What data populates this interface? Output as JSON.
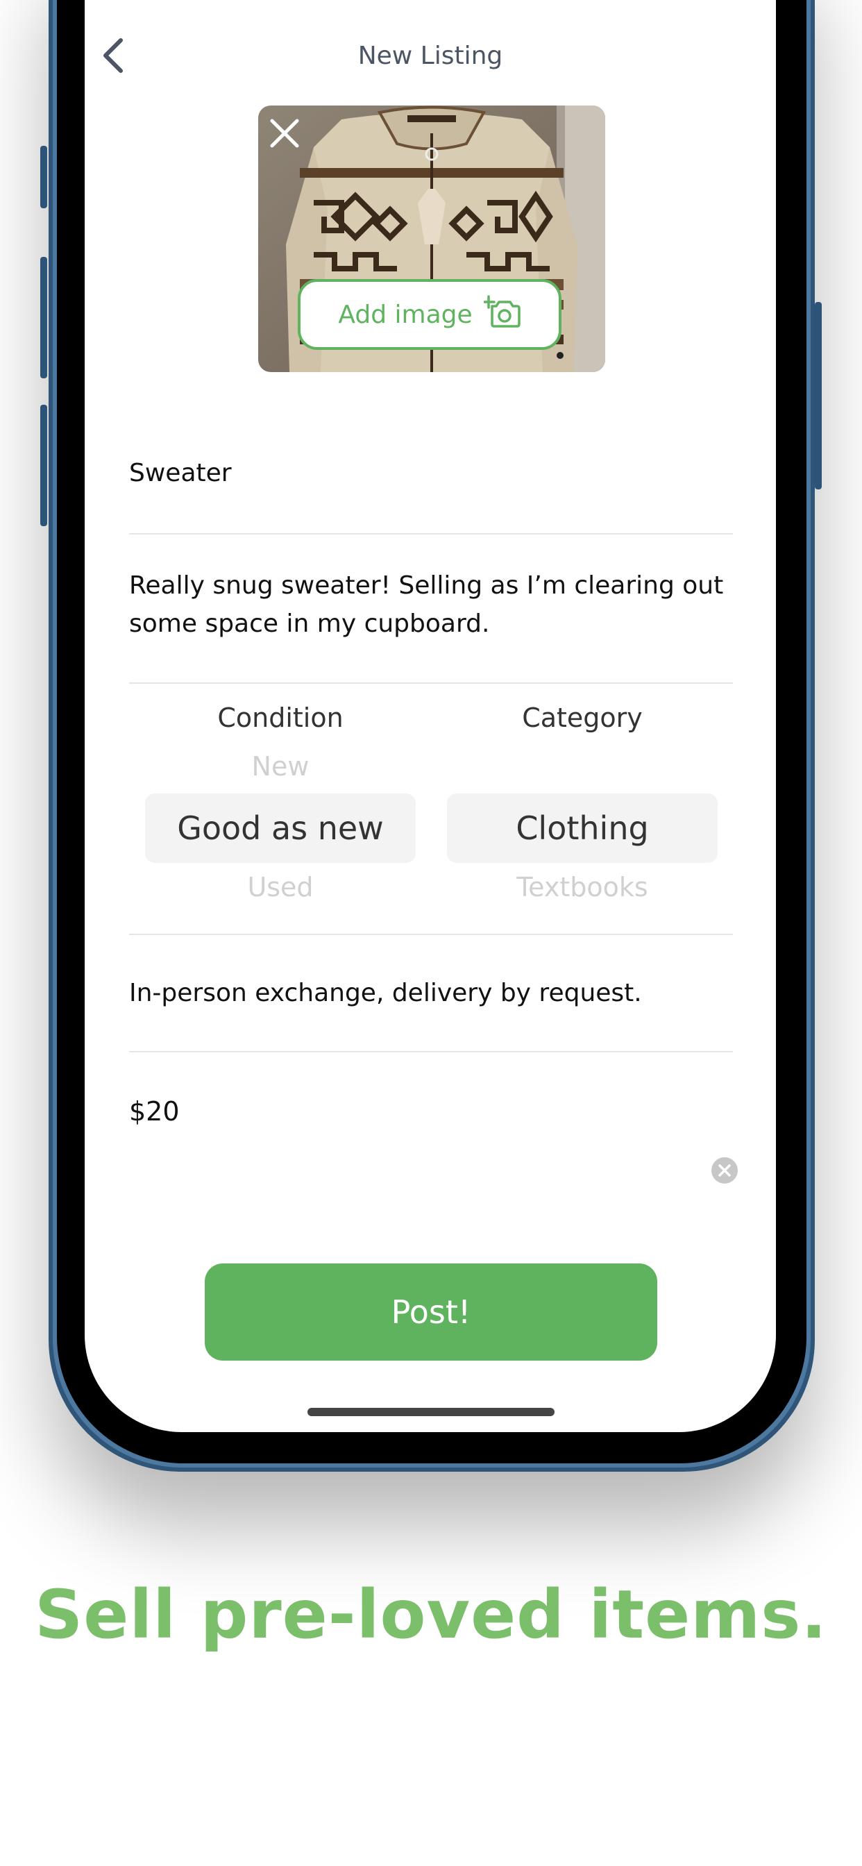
{
  "screen": {
    "title": "New Listing",
    "add_image_label": "Add image",
    "listing": {
      "title_value": "Sweater",
      "description_value": "Really snug sweater! Selling as I’m clearing out some space in my cupboard.",
      "delivery_value": "In-person exchange, delivery by request.",
      "price_value": "$20"
    },
    "pickers": {
      "condition": {
        "label": "Condition",
        "above": "New",
        "selected": "Good as new",
        "below": "Used"
      },
      "category": {
        "label": "Category",
        "above": "",
        "selected": "Clothing",
        "below": "Textbooks"
      }
    },
    "post_label": "Post!"
  },
  "tagline": "Sell pre-loved items.",
  "colors": {
    "accent": "#5fb35f",
    "tagline": "#7cbf6b",
    "phone_frame": "#2f5578"
  },
  "icons": [
    "chevron-left-icon",
    "close-icon",
    "camera-plus-icon",
    "clear-circle-icon"
  ]
}
